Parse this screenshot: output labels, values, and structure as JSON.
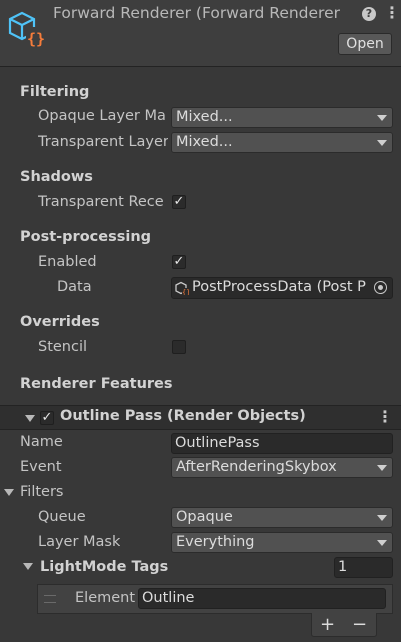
{
  "header": {
    "title": "Forward Renderer (Forward Renderer",
    "open_label": "Open",
    "help_icon": "help-icon",
    "menu_icon": "kebab-menu-icon"
  },
  "filtering": {
    "title": "Filtering",
    "opaque_label": "Opaque Layer Ma",
    "opaque_value": "Mixed...",
    "transparent_label": "Transparent Layer",
    "transparent_value": "Mixed..."
  },
  "shadows": {
    "title": "Shadows",
    "transparent_receive_label": "Transparent Rece",
    "transparent_receive_checked": true
  },
  "post_processing": {
    "title": "Post-processing",
    "enabled_label": "Enabled",
    "enabled_checked": true,
    "data_label": "Data",
    "data_value": "PostProcessData (Post P"
  },
  "overrides": {
    "title": "Overrides",
    "stencil_label": "Stencil",
    "stencil_checked": false
  },
  "renderer_features": {
    "title": "Renderer Features",
    "feature": {
      "enabled": true,
      "title": "Outline Pass (Render Objects)",
      "name_label": "Name",
      "name_value": "OutlinePass",
      "event_label": "Event",
      "event_value": "AfterRenderingSkybox",
      "filters_label": "Filters",
      "queue_label": "Queue",
      "queue_value": "Opaque",
      "layer_mask_label": "Layer Mask",
      "layer_mask_value": "Everything",
      "lightmode_label": "LightMode Tags",
      "lightmode_count": "1",
      "element_label": "Element",
      "element_value": "Outline",
      "add_label": "+",
      "remove_label": "−"
    }
  },
  "colors": {
    "background": "#383838",
    "header": "#3e3e3e",
    "accent_icon": "#4fc3f7",
    "script_icon": "#f57c3b"
  }
}
